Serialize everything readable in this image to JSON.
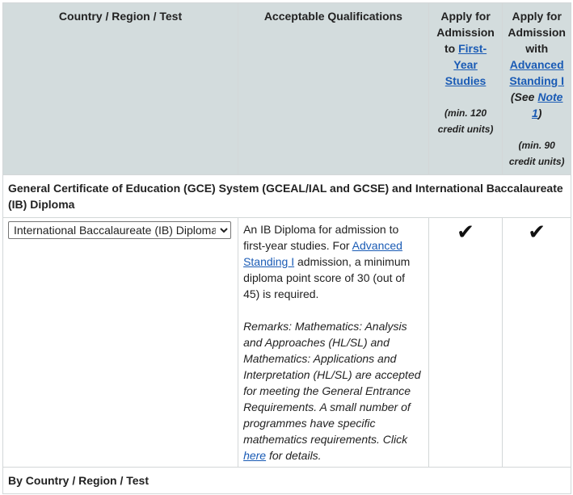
{
  "headers": {
    "col1": "Country / Region / Test",
    "col2": "Acceptable Qualifications",
    "col3_pre": "Apply for Admission to ",
    "col3_link": "First-Year Studies",
    "col3_note": "(min. 120 credit units)",
    "col4_pre": "Apply for Admission with ",
    "col4_link": "Advanced Standing I",
    "col4_see_pre": "(See ",
    "col4_see_link": "Note 1",
    "col4_see_post": ")",
    "col4_note": "(min. 90 credit units)"
  },
  "section_title": "General Certificate of Education (GCE) System (GCEAL/IAL and GCSE) and International Baccalaureate (IB) Diploma",
  "row": {
    "select_value": "International Baccalaureate (IB) Diploma",
    "desc_pre": "An IB Diploma for admission to first-year studies. For ",
    "desc_link": "Advanced Standing I",
    "desc_post": " admission, a minimum diploma point score of 30 (out of 45) is required.",
    "remarks_pre": "Remarks: Mathematics: Analysis and Approaches (HL/SL) and Mathematics: Applications and Interpretation (HL/SL) are accepted for meeting the General Entrance Requirements. A small number of programmes have specific mathematics requirements. Click ",
    "remarks_link": "here",
    "remarks_post": " for details.",
    "check_first_year": "✔",
    "check_advanced": "✔"
  },
  "footer_title": "By Country / Region / Test"
}
